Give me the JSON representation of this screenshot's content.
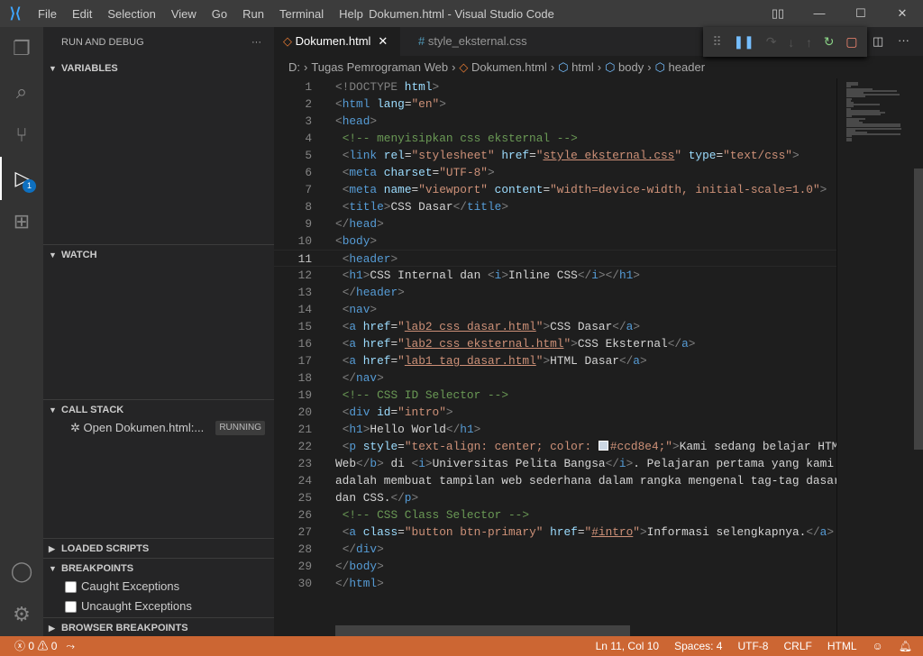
{
  "window": {
    "title": "Dokumen.html - Visual Studio Code",
    "menu": [
      "File",
      "Edit",
      "Selection",
      "View",
      "Go",
      "Run",
      "Terminal",
      "Help"
    ]
  },
  "sidebar": {
    "title": "RUN AND DEBUG",
    "sections": {
      "variables": "VARIABLES",
      "watch": "WATCH",
      "call_stack": "CALL STACK",
      "loaded_scripts": "LOADED SCRIPTS",
      "breakpoints": "BREAKPOINTS",
      "browser_breakpoints": "BROWSER BREAKPOINTS"
    },
    "call_stack_item": "Open Dokumen.html:...",
    "call_stack_status": "RUNNING",
    "breakpoints": [
      {
        "label": "Caught Exceptions",
        "checked": false
      },
      {
        "label": "Uncaught Exceptions",
        "checked": false
      }
    ],
    "debug_badge": "1"
  },
  "tabs": [
    {
      "label": "Dokumen.html",
      "active": true
    },
    {
      "label": "style_eksternal.css",
      "active": false
    }
  ],
  "breadcrumb": [
    "D:",
    "Tugas Pemrograman Web",
    "Dokumen.html",
    "html",
    "body",
    "header"
  ],
  "editor": {
    "current_line": 11,
    "lines": [
      [
        [
          "p",
          "<!DOCTYPE "
        ],
        [
          "a",
          "html"
        ],
        [
          "p",
          ">"
        ]
      ],
      [
        [
          "p",
          "<"
        ],
        [
          "t",
          "html"
        ],
        [
          "x",
          " "
        ],
        [
          "a",
          "lang"
        ],
        [
          "x",
          "="
        ],
        [
          "s",
          "\"en\""
        ],
        [
          "p",
          ">"
        ]
      ],
      [
        [
          "p",
          "<"
        ],
        [
          "t",
          "head"
        ],
        [
          "p",
          ">"
        ]
      ],
      [
        [
          "x",
          " "
        ],
        [
          "c",
          "<!-- menyisipkan css eksternal -->"
        ]
      ],
      [
        [
          "x",
          " "
        ],
        [
          "p",
          "<"
        ],
        [
          "t",
          "link"
        ],
        [
          "x",
          " "
        ],
        [
          "a",
          "rel"
        ],
        [
          "x",
          "="
        ],
        [
          "s",
          "\"stylesheet\""
        ],
        [
          "x",
          " "
        ],
        [
          "a",
          "href"
        ],
        [
          "x",
          "="
        ],
        [
          "s",
          "\""
        ],
        [
          "u",
          "style_eksternal.css"
        ],
        [
          "s",
          "\""
        ],
        [
          "x",
          " "
        ],
        [
          "a",
          "type"
        ],
        [
          "x",
          "="
        ],
        [
          "s",
          "\"text/css\""
        ],
        [
          "p",
          ">"
        ]
      ],
      [
        [
          "x",
          " "
        ],
        [
          "p",
          "<"
        ],
        [
          "t",
          "meta"
        ],
        [
          "x",
          " "
        ],
        [
          "a",
          "charset"
        ],
        [
          "x",
          "="
        ],
        [
          "s",
          "\"UTF-8\""
        ],
        [
          "p",
          ">"
        ]
      ],
      [
        [
          "x",
          " "
        ],
        [
          "p",
          "<"
        ],
        [
          "t",
          "meta"
        ],
        [
          "x",
          " "
        ],
        [
          "a",
          "name"
        ],
        [
          "x",
          "="
        ],
        [
          "s",
          "\"viewport\""
        ],
        [
          "x",
          " "
        ],
        [
          "a",
          "content"
        ],
        [
          "x",
          "="
        ],
        [
          "s",
          "\"width=device-width, initial-scale=1.0\""
        ],
        [
          "p",
          ">"
        ]
      ],
      [
        [
          "x",
          " "
        ],
        [
          "p",
          "<"
        ],
        [
          "t",
          "title"
        ],
        [
          "p",
          ">"
        ],
        [
          "x",
          "CSS Dasar"
        ],
        [
          "p",
          "</"
        ],
        [
          "t",
          "title"
        ],
        [
          "p",
          ">"
        ]
      ],
      [
        [
          "p",
          "</"
        ],
        [
          "t",
          "head"
        ],
        [
          "p",
          ">"
        ]
      ],
      [
        [
          "p",
          "<"
        ],
        [
          "t",
          "body"
        ],
        [
          "p",
          ">"
        ]
      ],
      [
        [
          "x",
          " "
        ],
        [
          "p",
          "<"
        ],
        [
          "t",
          "header"
        ],
        [
          "p",
          ">"
        ]
      ],
      [
        [
          "x",
          " "
        ],
        [
          "p",
          "<"
        ],
        [
          "t",
          "h1"
        ],
        [
          "p",
          ">"
        ],
        [
          "x",
          "CSS Internal dan "
        ],
        [
          "p",
          "<"
        ],
        [
          "t",
          "i"
        ],
        [
          "p",
          ">"
        ],
        [
          "x",
          "Inline CSS"
        ],
        [
          "p",
          "</"
        ],
        [
          "t",
          "i"
        ],
        [
          "p",
          "></"
        ],
        [
          "t",
          "h1"
        ],
        [
          "p",
          ">"
        ]
      ],
      [
        [
          "x",
          " "
        ],
        [
          "p",
          "</"
        ],
        [
          "t",
          "header"
        ],
        [
          "p",
          ">"
        ]
      ],
      [
        [
          "x",
          " "
        ],
        [
          "p",
          "<"
        ],
        [
          "t",
          "nav"
        ],
        [
          "p",
          ">"
        ]
      ],
      [
        [
          "x",
          " "
        ],
        [
          "p",
          "<"
        ],
        [
          "t",
          "a"
        ],
        [
          "x",
          " "
        ],
        [
          "a",
          "href"
        ],
        [
          "x",
          "="
        ],
        [
          "s",
          "\""
        ],
        [
          "u",
          "lab2_css_dasar.html"
        ],
        [
          "s",
          "\""
        ],
        [
          "p",
          ">"
        ],
        [
          "x",
          "CSS Dasar"
        ],
        [
          "p",
          "</"
        ],
        [
          "t",
          "a"
        ],
        [
          "p",
          ">"
        ]
      ],
      [
        [
          "x",
          " "
        ],
        [
          "p",
          "<"
        ],
        [
          "t",
          "a"
        ],
        [
          "x",
          " "
        ],
        [
          "a",
          "href"
        ],
        [
          "x",
          "="
        ],
        [
          "s",
          "\""
        ],
        [
          "u",
          "lab2_css_eksternal.html"
        ],
        [
          "s",
          "\""
        ],
        [
          "p",
          ">"
        ],
        [
          "x",
          "CSS Eksternal"
        ],
        [
          "p",
          "</"
        ],
        [
          "t",
          "a"
        ],
        [
          "p",
          ">"
        ]
      ],
      [
        [
          "x",
          " "
        ],
        [
          "p",
          "<"
        ],
        [
          "t",
          "a"
        ],
        [
          "x",
          " "
        ],
        [
          "a",
          "href"
        ],
        [
          "x",
          "="
        ],
        [
          "s",
          "\""
        ],
        [
          "u",
          "lab1_tag_dasar.html"
        ],
        [
          "s",
          "\""
        ],
        [
          "p",
          ">"
        ],
        [
          "x",
          "HTML Dasar"
        ],
        [
          "p",
          "</"
        ],
        [
          "t",
          "a"
        ],
        [
          "p",
          ">"
        ]
      ],
      [
        [
          "x",
          " "
        ],
        [
          "p",
          "</"
        ],
        [
          "t",
          "nav"
        ],
        [
          "p",
          ">"
        ]
      ],
      [
        [
          "x",
          " "
        ],
        [
          "c",
          "<!-- CSS ID Selector -->"
        ]
      ],
      [
        [
          "x",
          " "
        ],
        [
          "p",
          "<"
        ],
        [
          "t",
          "div"
        ],
        [
          "x",
          " "
        ],
        [
          "a",
          "id"
        ],
        [
          "x",
          "="
        ],
        [
          "s",
          "\"intro\""
        ],
        [
          "p",
          ">"
        ]
      ],
      [
        [
          "x",
          " "
        ],
        [
          "p",
          "<"
        ],
        [
          "t",
          "h1"
        ],
        [
          "p",
          ">"
        ],
        [
          "x",
          "Hello World"
        ],
        [
          "p",
          "</"
        ],
        [
          "t",
          "h1"
        ],
        [
          "p",
          ">"
        ]
      ],
      [
        [
          "x",
          " "
        ],
        [
          "p",
          "<"
        ],
        [
          "t",
          "p"
        ],
        [
          "x",
          " "
        ],
        [
          "a",
          "style"
        ],
        [
          "x",
          "="
        ],
        [
          "s",
          "\"text-align: center; color: "
        ],
        [
          "sw",
          ""
        ],
        [
          "s",
          "#ccd8e4;\""
        ],
        [
          "p",
          ">"
        ],
        [
          "x",
          "Kami sedang belajar HTML"
        ]
      ],
      [
        [
          "x",
          "Web"
        ],
        [
          "p",
          "</"
        ],
        [
          "t",
          "b"
        ],
        [
          "p",
          ">"
        ],
        [
          "x",
          " di "
        ],
        [
          "p",
          "<"
        ],
        [
          "t",
          "i"
        ],
        [
          "p",
          ">"
        ],
        [
          "x",
          "Universitas Pelita Bangsa"
        ],
        [
          "p",
          "</"
        ],
        [
          "t",
          "i"
        ],
        [
          "p",
          ">"
        ],
        [
          "x",
          ". Pelajaran pertama yang kami"
        ]
      ],
      [
        [
          "x",
          "adalah membuat tampilan web sederhana dalam rangka mengenal tag-tag dasar"
        ]
      ],
      [
        [
          "x",
          "dan CSS."
        ],
        [
          "p",
          "</"
        ],
        [
          "t",
          "p"
        ],
        [
          "p",
          ">"
        ]
      ],
      [
        [
          "x",
          " "
        ],
        [
          "c",
          "<!-- CSS Class Selector -->"
        ]
      ],
      [
        [
          "x",
          " "
        ],
        [
          "p",
          "<"
        ],
        [
          "t",
          "a"
        ],
        [
          "x",
          " "
        ],
        [
          "a",
          "class"
        ],
        [
          "x",
          "="
        ],
        [
          "s",
          "\"button btn-primary\""
        ],
        [
          "x",
          " "
        ],
        [
          "a",
          "href"
        ],
        [
          "x",
          "="
        ],
        [
          "s",
          "\""
        ],
        [
          "u",
          "#intro"
        ],
        [
          "s",
          "\""
        ],
        [
          "p",
          ">"
        ],
        [
          "x",
          "Informasi selengkapnya."
        ],
        [
          "p",
          "</"
        ],
        [
          "t",
          "a"
        ],
        [
          "p",
          ">"
        ]
      ],
      [
        [
          "x",
          " "
        ],
        [
          "p",
          "</"
        ],
        [
          "t",
          "div"
        ],
        [
          "p",
          ">"
        ]
      ],
      [
        [
          "p",
          "</"
        ],
        [
          "t",
          "body"
        ],
        [
          "p",
          ">"
        ]
      ],
      [
        [
          "p",
          "</"
        ],
        [
          "t",
          "html"
        ],
        [
          "p",
          ">"
        ]
      ]
    ]
  },
  "status": {
    "errors": "0",
    "warnings": "0",
    "position": "Ln 11, Col 10",
    "spaces": "Spaces: 4",
    "encoding": "UTF-8",
    "eol": "CRLF",
    "language": "HTML"
  },
  "colors": {
    "status_bar": "#cc6633",
    "swatch": "#ccd8e4"
  }
}
